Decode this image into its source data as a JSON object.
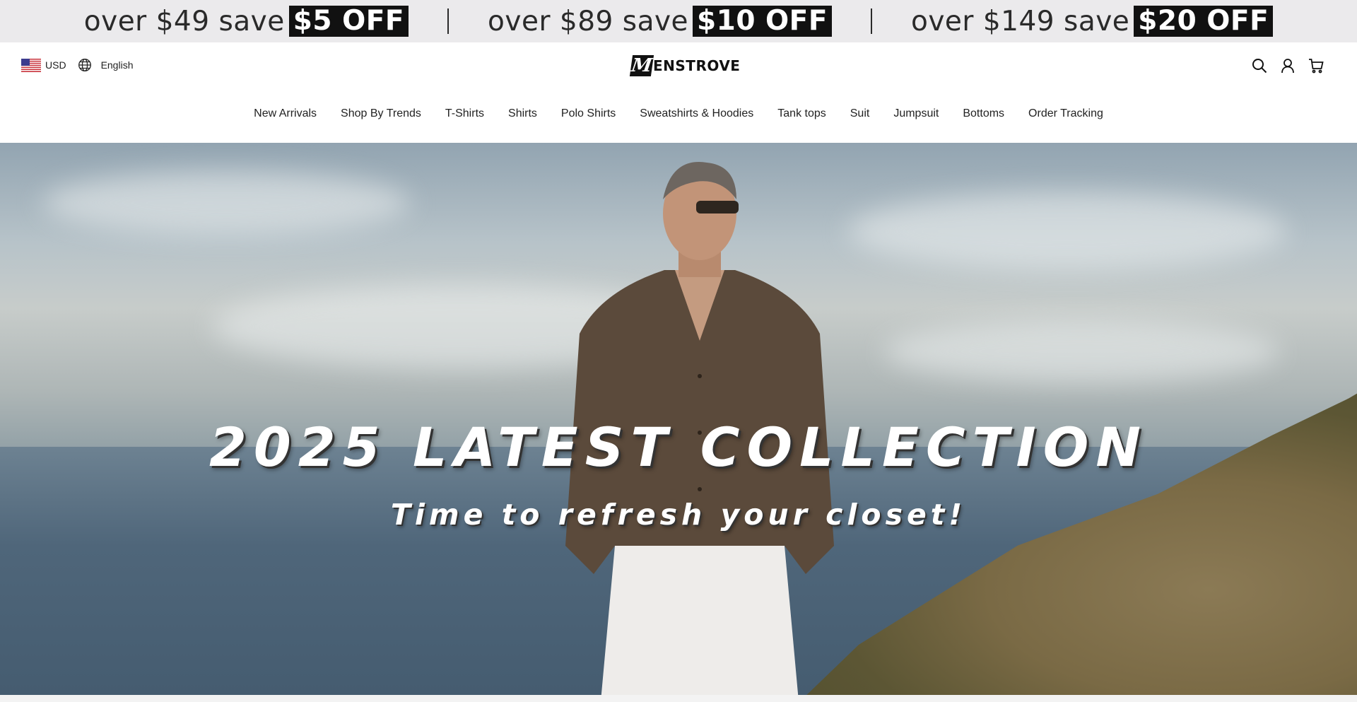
{
  "promo_bar": {
    "items": [
      {
        "prefix": "over $49 save",
        "badge": "$5 OFF"
      },
      {
        "prefix": "over $89 save",
        "badge": "$10 OFF"
      },
      {
        "prefix": "over $149 save",
        "badge": "$20 OFF"
      }
    ],
    "separator": "|"
  },
  "header": {
    "currency": "USD",
    "language": "English",
    "logo_mark": "M",
    "logo_text": "ENSTROVE",
    "icons": [
      "search-icon",
      "account-icon",
      "cart-icon"
    ]
  },
  "nav": {
    "items": [
      "New Arrivals",
      "Shop By Trends",
      "T-Shirts",
      "Shirts",
      "Polo Shirts",
      "Sweatshirts & Hoodies",
      "Tank tops",
      "Suit",
      "Jumpsuit",
      "Bottoms",
      "Order Tracking"
    ]
  },
  "hero": {
    "title": "2025 LATEST COLLECTION",
    "subtitle": "Time to refresh your closet!"
  },
  "colors": {
    "promo_bg": "#ebeaec",
    "badge_bg": "#111111",
    "text": "#222222"
  }
}
